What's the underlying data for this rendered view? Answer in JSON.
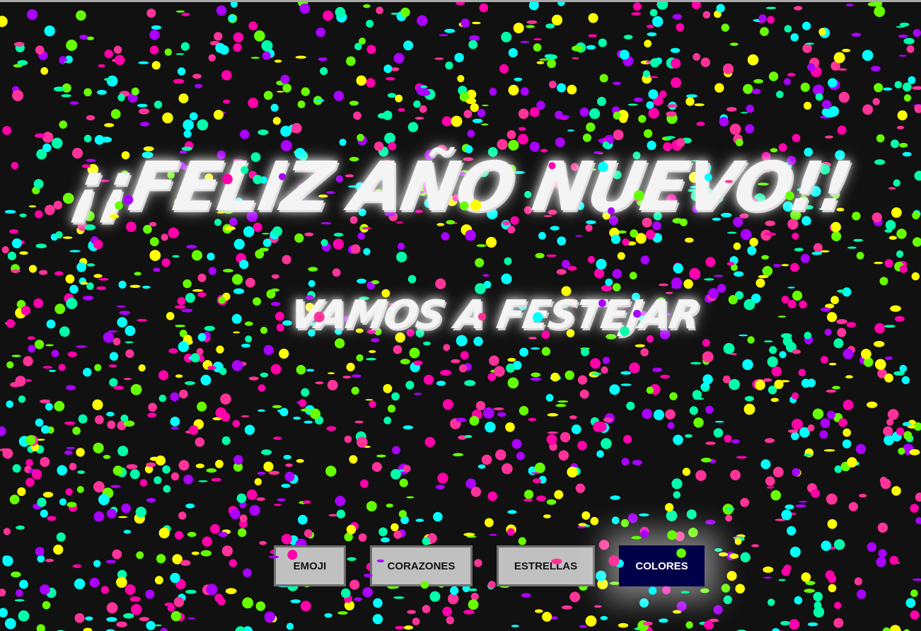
{
  "heading": {
    "title": "¡¡FELIZ AÑO NUEVO!!",
    "subtitle": "VAMOS A FESTEJAR"
  },
  "buttons": [
    {
      "label": "EMOJI",
      "active": false
    },
    {
      "label": "CORAZONES",
      "active": false
    },
    {
      "label": "ESTRELLAS",
      "active": false
    },
    {
      "label": "COLORES",
      "active": true
    }
  ],
  "confetti": {
    "colors": [
      "#ffff00",
      "#ff00aa",
      "#00ffff",
      "#66ff00",
      "#aa00ff",
      "#00ffaa",
      "#ff3399"
    ],
    "background": "#111111"
  }
}
